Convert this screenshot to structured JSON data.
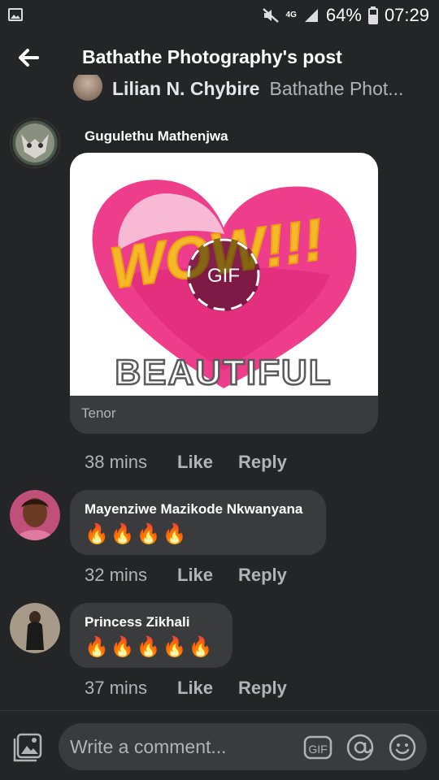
{
  "status_bar": {
    "network": "4G",
    "battery": "64%",
    "time": "07:29"
  },
  "header": {
    "title": "Bathathe Photography's post"
  },
  "previous_comment": {
    "name": "Lilian N. Chybire",
    "text": "Bathathe Phot..."
  },
  "comments": [
    {
      "name": "Gugulethu Mathenjwa",
      "gif": {
        "text_wow": "WOW!!!",
        "text_beautiful": "BEAUTIFUL",
        "badge": "GIF",
        "source": "Tenor"
      },
      "time": "38 mins",
      "like": "Like",
      "reply": "Reply"
    },
    {
      "name": "Mayenziwe Mazikode Nkwanyana",
      "emojis": "🔥🔥🔥🔥",
      "time": "32 mins",
      "like": "Like",
      "reply": "Reply"
    },
    {
      "name": "Princess Zikhali",
      "emojis": "🔥🔥🔥🔥🔥",
      "time": "37 mins",
      "like": "Like",
      "reply": "Reply"
    }
  ],
  "composer": {
    "placeholder": "Write a comment...",
    "gif_label": "GIF"
  },
  "colors": {
    "background": "#242526",
    "bubble": "#3a3b3c",
    "secondary_text": "#b0b3b8"
  }
}
